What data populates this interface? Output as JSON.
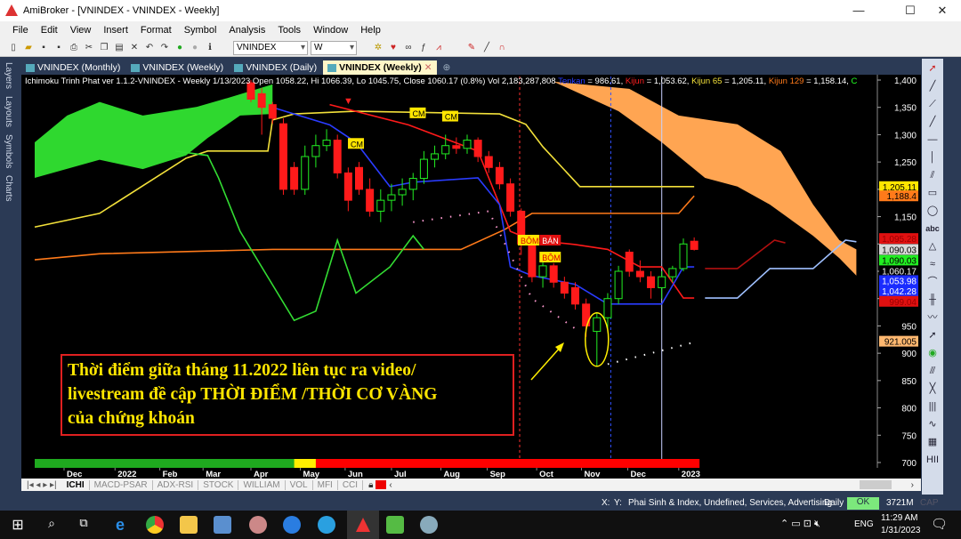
{
  "window": {
    "title": "AmiBroker - [VNINDEX - VNINDEX - Weekly]",
    "min": "—",
    "max": "☐",
    "close": "✕"
  },
  "menu": [
    "File",
    "Edit",
    "View",
    "Insert",
    "Format",
    "Symbol",
    "Analysis",
    "Tools",
    "Window",
    "Help"
  ],
  "toolbar": {
    "symbol": "VNINDEX",
    "interval": "W"
  },
  "left_panel": [
    "Layers",
    "Layouts",
    "Symbols",
    "Charts"
  ],
  "tabs": [
    {
      "label": "VNINDEX (Monthly)"
    },
    {
      "label": "VNINDEX (Weekly)"
    },
    {
      "label": "VNINDEX (Daily)"
    },
    {
      "label": "VNINDEX (Weekly)",
      "active": true
    }
  ],
  "info": {
    "prefix": "Ichimoku Trinh Phat ver 1.1.2-VNINDEX - Weekly 1/13/2023 Open 1058.22, Hi 1066.39, Lo 1045.75, Close 1060.17 (0.8%) Vol 2,183,287,808 ",
    "tenkan": "Tenkan",
    "tenkan_val": " = 986.61, ",
    "kijun": "Kijun",
    "kijun_val": " = 1,053.62, ",
    "kijun65": "Kijun 65",
    "kijun65_val": " = 1,205.11, ",
    "kijun129": "Kijun 129",
    "kijun129_val": " = 1,158.14, ",
    "c": "C"
  },
  "chart_data": {
    "type": "candlestick",
    "interval": "Weekly",
    "first_date": "2022-04-01",
    "ylim": [
      700,
      1400
    ],
    "yticks": [
      1400,
      1350,
      1300,
      1250,
      1200,
      1150,
      1100,
      1050,
      1000,
      950,
      900,
      850,
      800,
      750,
      700
    ],
    "ytick_labels": [
      "1,400",
      "1,350",
      "1,300",
      "1,250",
      "1,200",
      "1,150",
      "",
      "",
      "",
      "950",
      "900",
      "850",
      "800",
      "750",
      "700"
    ],
    "xticks": [
      {
        "label": "Dec",
        "date": "2021-12-01"
      },
      {
        "label": "2022",
        "date": "2022-01-03"
      },
      {
        "label": "Feb",
        "date": "2022-02-01"
      },
      {
        "label": "Mar",
        "date": "2022-03-01"
      },
      {
        "label": "Apr",
        "date": "2022-04-01"
      },
      {
        "label": "May",
        "date": "2022-05-03"
      },
      {
        "label": "Jun",
        "date": "2022-06-01"
      },
      {
        "label": "Jul",
        "date": "2022-07-01"
      },
      {
        "label": "Aug",
        "date": "2022-08-02"
      },
      {
        "label": "Sep",
        "date": "2022-09-01"
      },
      {
        "label": "Oct",
        "date": "2022-10-03"
      },
      {
        "label": "Nov",
        "date": "2022-11-01"
      },
      {
        "label": "Dec",
        "date": "2022-12-01"
      },
      {
        "label": "2023",
        "date": "2023-01-03"
      }
    ],
    "candles": [
      [
        1395,
        1400,
        1360,
        1365
      ],
      [
        1375,
        1385,
        1300,
        1350
      ],
      [
        1355,
        1360,
        1320,
        1330
      ],
      [
        1320,
        1330,
        1190,
        1200
      ],
      [
        1240,
        1250,
        1190,
        1200
      ],
      [
        1200,
        1280,
        1190,
        1260
      ],
      [
        1260,
        1300,
        1240,
        1280
      ],
      [
        1280,
        1310,
        1270,
        1290
      ],
      [
        1290,
        1300,
        1220,
        1230
      ],
      [
        1230,
        1240,
        1160,
        1180
      ],
      [
        1240,
        1250,
        1190,
        1200
      ],
      [
        1200,
        1220,
        1150,
        1160
      ],
      [
        1160,
        1200,
        1140,
        1180
      ],
      [
        1180,
        1210,
        1160,
        1190
      ],
      [
        1190,
        1220,
        1170,
        1200
      ],
      [
        1200,
        1230,
        1180,
        1220
      ],
      [
        1220,
        1270,
        1210,
        1255
      ],
      [
        1255,
        1280,
        1240,
        1265
      ],
      [
        1265,
        1300,
        1255,
        1280
      ],
      [
        1280,
        1295,
        1265,
        1275
      ],
      [
        1275,
        1300,
        1265,
        1290
      ],
      [
        1290,
        1295,
        1250,
        1260
      ],
      [
        1260,
        1270,
        1230,
        1240
      ],
      [
        1240,
        1250,
        1200,
        1210
      ],
      [
        1210,
        1220,
        1150,
        1160
      ],
      [
        1160,
        1165,
        1080,
        1100
      ],
      [
        1100,
        1110,
        1030,
        1040
      ],
      [
        1040,
        1070,
        1020,
        1060
      ],
      [
        1060,
        1065,
        1020,
        1030
      ],
      [
        1030,
        1040,
        1000,
        1010
      ],
      [
        1020,
        1030,
        980,
        990
      ],
      [
        990,
        1000,
        930,
        950
      ],
      [
        940,
        975,
        875,
        965
      ],
      [
        965,
        1010,
        940,
        1000
      ],
      [
        1000,
        1060,
        990,
        1050
      ],
      [
        1085,
        1090,
        1040,
        1050
      ],
      [
        1050,
        1070,
        1030,
        1040
      ],
      [
        1040,
        1050,
        1000,
        1020
      ],
      [
        1020,
        1050,
        1000,
        1040
      ],
      [
        1040,
        1060,
        1030,
        1055
      ],
      [
        1055,
        1110,
        1050,
        1100
      ],
      [
        1105,
        1112,
        1088,
        1090
      ]
    ],
    "lines": [
      {
        "name": "Kijun 65",
        "color": "#f2e03a",
        "points": [
          [
            "2021-11-12",
            1131
          ],
          [
            "2021-12-24",
            1156
          ],
          [
            "2022-02-18",
            1257
          ],
          [
            "2022-03-04",
            1270
          ],
          [
            "2022-04-12",
            1270
          ],
          [
            "2022-04-15",
            1327
          ],
          [
            "2022-04-29",
            1338
          ],
          [
            "2022-06-08",
            1343
          ],
          [
            "2022-09-09",
            1338
          ],
          [
            "2022-09-26",
            1319
          ],
          [
            "2022-10-07",
            1278
          ],
          [
            "2022-10-31",
            1205
          ],
          [
            "2023-01-13",
            1205
          ]
        ]
      },
      {
        "name": "Kijun 129",
        "color": "#ff7a1a",
        "points": [
          [
            "2021-11-12",
            1071
          ],
          [
            "2021-12-24",
            1082
          ],
          [
            "2022-04-15",
            1090
          ],
          [
            "2022-08-15",
            1090
          ],
          [
            "2022-09-12",
            1126
          ],
          [
            "2022-09-30",
            1156
          ],
          [
            "2022-11-18",
            1156
          ],
          [
            "2023-01-03",
            1156
          ],
          [
            "2023-01-13",
            1188
          ]
        ]
      },
      {
        "name": "Kijun",
        "color": "#ff1a1a",
        "points": [
          [
            "2022-05-22",
            1355
          ],
          [
            "2022-07-12",
            1318
          ],
          [
            "2022-08-26",
            1270
          ],
          [
            "2022-09-09",
            1172
          ],
          [
            "2022-09-16",
            1123
          ],
          [
            "2022-09-30",
            1107
          ],
          [
            "2022-10-28",
            1099
          ],
          [
            "2022-11-18",
            1090
          ],
          [
            "2022-12-09",
            1058
          ],
          [
            "2022-12-23",
            1058
          ],
          [
            "2023-01-06",
            1001
          ],
          [
            "2023-01-13",
            1001
          ]
        ]
      },
      {
        "name": "Tenkan",
        "color": "#2a3cff",
        "points": [
          [
            "2022-04-15",
            1350
          ],
          [
            "2022-05-22",
            1318
          ],
          [
            "2022-06-08",
            1286
          ],
          [
            "2022-06-30",
            1205
          ],
          [
            "2022-07-15",
            1213
          ],
          [
            "2022-08-26",
            1221
          ],
          [
            "2022-09-09",
            1172
          ],
          [
            "2022-09-16",
            1058
          ],
          [
            "2022-09-30",
            1042
          ],
          [
            "2022-10-28",
            1026
          ],
          [
            "2022-11-18",
            990
          ],
          [
            "2022-12-23",
            990
          ],
          [
            "2023-01-06",
            1058
          ],
          [
            "2023-01-13",
            1058
          ]
        ]
      },
      {
        "name": "",
        "color": "#b01010",
        "points": [
          [
            "2023-01-20",
            1055
          ],
          [
            "2023-02-10",
            1055
          ],
          [
            "2023-03-06",
            1107
          ],
          [
            "2023-03-13",
            1102
          ]
        ]
      },
      {
        "name": "",
        "color": "#9fc0ff",
        "points": [
          [
            "2023-01-20",
            1001
          ],
          [
            "2023-02-10",
            1001
          ],
          [
            "2023-03-03",
            1055
          ],
          [
            "2023-03-31",
            1055
          ],
          [
            "2023-04-21",
            1107
          ],
          [
            "2023-04-28",
            1104
          ]
        ]
      },
      {
        "name": "",
        "color": "#33dd33",
        "points": [
          [
            "2022-02-11",
            1270
          ],
          [
            "2022-03-04",
            1262
          ],
          [
            "2022-03-11",
            1221
          ],
          [
            "2022-03-25",
            1123
          ],
          [
            "2022-04-29",
            960
          ],
          [
            "2022-05-13",
            977
          ],
          [
            "2022-05-27",
            1107
          ],
          [
            "2022-06-08",
            1010
          ],
          [
            "2022-06-30",
            1058
          ],
          [
            "2022-07-15",
            1115
          ],
          [
            "2022-07-22",
            1090
          ]
        ]
      }
    ],
    "clouds": [
      {
        "color": "#2fd82f",
        "upper": [
          [
            "2021-11-12",
            1286
          ],
          [
            "2021-12-03",
            1335
          ],
          [
            "2021-12-24",
            1360
          ],
          [
            "2022-01-21",
            1335
          ],
          [
            "2022-02-25",
            1351
          ],
          [
            "2022-03-18",
            1368
          ],
          [
            "2022-04-15",
            1392
          ]
        ],
        "lower": [
          [
            "2021-11-12",
            1221
          ],
          [
            "2021-12-24",
            1254
          ],
          [
            "2022-01-21",
            1237
          ],
          [
            "2022-02-18",
            1262
          ],
          [
            "2022-03-04",
            1294
          ],
          [
            "2022-03-25",
            1335
          ],
          [
            "2022-04-15",
            1338
          ]
        ]
      },
      {
        "color": "#ffa552",
        "upper": [
          [
            "2022-10-14",
            1397
          ],
          [
            "2022-12-02",
            1384
          ],
          [
            "2023-01-03",
            1335
          ],
          [
            "2023-02-10",
            1319
          ],
          [
            "2023-03-10",
            1270
          ],
          [
            "2023-03-31",
            1172
          ],
          [
            "2023-04-17",
            1107
          ],
          [
            "2023-04-28",
            1090
          ]
        ],
        "lower": [
          [
            "2022-10-14",
            1397
          ],
          [
            "2022-11-25",
            1343
          ],
          [
            "2022-12-23",
            1286
          ],
          [
            "2023-01-20",
            1221
          ],
          [
            "2023-02-10",
            1205
          ],
          [
            "2023-03-03",
            1172
          ],
          [
            "2023-03-31",
            1115
          ],
          [
            "2023-04-17",
            1074
          ],
          [
            "2023-04-28",
            1042
          ]
        ]
      }
    ],
    "dotted": [
      {
        "color": "#ff9ad0",
        "points": [
          [
            "2022-07-15",
            1140
          ],
          [
            "2022-09-02",
            1160
          ],
          [
            "2022-09-30",
            1000
          ],
          [
            "2022-10-28",
            945
          ]
        ]
      },
      {
        "color": "#ffffff",
        "points": [
          [
            "2022-11-18",
            880
          ],
          [
            "2023-01-13",
            920
          ]
        ]
      }
    ],
    "vlines": [
      {
        "date": "2022-09-22",
        "color": "#ff3030",
        "style": "dash"
      },
      {
        "date": "2022-11-20",
        "color": "#3050ff",
        "style": "dash"
      },
      {
        "date": "2022-12-23",
        "color": "#c8d0ff",
        "style": "solid"
      }
    ],
    "signals": [
      {
        "text": "CM",
        "date": "2022-07-18",
        "price": 1340,
        "bg": "#ffe600",
        "fg": "#000"
      },
      {
        "text": "CM",
        "date": "2022-08-08",
        "price": 1334,
        "bg": "#ffe600",
        "fg": "#000"
      },
      {
        "text": "CM",
        "date": "2022-06-08",
        "price": 1284,
        "bg": "#ffe600",
        "fg": "#000"
      },
      {
        "text": "BÔM",
        "date": "2022-09-26",
        "price": 1107,
        "bg": "#ffe600",
        "fg": "#d00"
      },
      {
        "text": "BÁN",
        "date": "2022-10-10",
        "price": 1107,
        "bg": "#e01010",
        "fg": "#fff"
      },
      {
        "text": "BÔM",
        "date": "2022-10-10",
        "price": 1076,
        "bg": "#ffe600",
        "fg": "#d00"
      }
    ],
    "price_labels": [
      {
        "text": "1,205.11",
        "price": 1205,
        "bg": "#ffe600",
        "fg": "#000"
      },
      {
        "text": "1,188.4",
        "price": 1188,
        "bg": "#ff7a1a",
        "fg": "#000"
      },
      {
        "text": "1,095.28",
        "price": 1110,
        "bg": "#e01010",
        "fg": "#900"
      },
      {
        "text": "1,090.03",
        "price": 1090,
        "bg": "#d8d8d8",
        "fg": "#000"
      },
      {
        "text": "1,090.03",
        "price": 1070,
        "bg": "#22ee22",
        "fg": "#000"
      },
      {
        "text": "1,060.17",
        "price": 1051,
        "bg": "#000",
        "fg": "#fff"
      },
      {
        "text": "1,053.98",
        "price": 1033,
        "bg": "#1a2cff",
        "fg": "#fff"
      },
      {
        "text": "1,042.28",
        "price": 1014,
        "bg": "#1a2cff",
        "fg": "#fff"
      },
      {
        "text": "999.04",
        "price": 995,
        "bg": "#e01010",
        "fg": "#900"
      },
      {
        "text": "921.005",
        "price": 922,
        "bg": "#ffb870",
        "fg": "#000"
      }
    ],
    "signal_bar": [
      {
        "color": "#1faa1f",
        "from": "2021-11-12",
        "to": "2022-04-29"
      },
      {
        "color": "#ffee00",
        "from": "2022-04-29",
        "to": "2022-05-13"
      },
      {
        "color": "#ff0000",
        "from": "2022-05-13",
        "to": "2023-01-13"
      }
    ],
    "colors": {
      "up": "#22ee22",
      "down": "#ff1a1a",
      "annotation_ellipse": "#ffee00"
    }
  },
  "annotation": {
    "lines": [
      "Thời điểm giữa tháng 11.2022 liên tục ra video/",
      "livestream đề cập THỜI ĐIỂM /THỜI CƠ VÀNG",
      "của chứng khoán"
    ]
  },
  "sheet_tabs": [
    "ICHI",
    "MACD-PSAR",
    "ADX-RSI",
    "STOCK",
    "WILLIAM",
    "VOL",
    "MFI",
    "CCI"
  ],
  "status": {
    "x": "X:",
    "y": "Y:",
    "category": "Phai Sinh & Index, Undefined, Services, Advertising",
    "interval": "Daily",
    "ok": "OK",
    "memory": "3721M",
    "cap": "CAP"
  },
  "taskbar": {
    "time": "11:29 AM",
    "date": "1/31/2023",
    "lang": "ENG"
  }
}
